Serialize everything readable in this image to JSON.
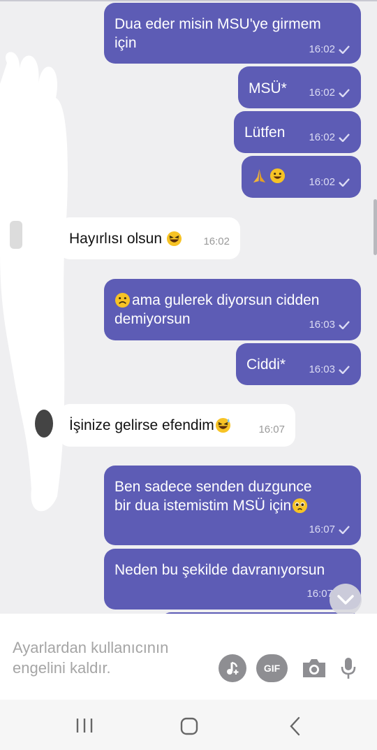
{
  "messages": [
    {
      "dir": "out",
      "text": "Dua eder misin MSU'ye girmem için",
      "time": "16:02"
    },
    {
      "dir": "out",
      "text": "MSÜ*",
      "time": "16:02"
    },
    {
      "dir": "out",
      "text": "Lütfen",
      "time": "16:02"
    },
    {
      "dir": "out",
      "text": "",
      "emoji": [
        "folded-hands",
        "grinning-face"
      ],
      "time": "16:02"
    },
    {
      "dir": "in",
      "text": "Hayırlısı olsun",
      "emoji_after": "grinning-squinting-face",
      "time": "16:02"
    },
    {
      "dir": "out",
      "text": "ama gulerek diyorsun cidden demiyorsun",
      "emoji_before": "frowning-face",
      "time": "16:03"
    },
    {
      "dir": "out",
      "text": "Ciddi*",
      "time": "16:03"
    },
    {
      "dir": "in",
      "text": "İşinize gelirse efendim",
      "emoji_after": "grinning-sweat-face",
      "time": "16:07"
    },
    {
      "dir": "out",
      "text": "Ben sadece senden duzgunce bir dua istemistim MSÜ için",
      "emoji_after": "pleading-face",
      "time": "16:07"
    },
    {
      "dir": "out",
      "text": "Neden bu şekilde davranıyorsun",
      "time": "16:07"
    }
  ],
  "msg1": {
    "line1": "Dua eder misin MSU'ye girmem",
    "line2": "için"
  },
  "msg6": {
    "line1": "ama gulerek diyorsun cidden",
    "line2": "demiyorsun"
  },
  "msg9": {
    "line1": "Ben sadece senden duzgunce",
    "line2": "bir dua istemistim MSÜ için"
  },
  "input": {
    "placeholder_line1": "Ayarlardan kullanıcının",
    "placeholder_line2": "engelini kaldır."
  },
  "icons": [
    "music-note-icon",
    "gif-icon",
    "camera-icon",
    "microphone-icon",
    "scroll-down-chevron-icon"
  ],
  "gif_label": "GIF",
  "colors": {
    "outgoing_bubble": "#5d5cb5",
    "incoming_bubble": "#ffffff",
    "chat_background": "#efeff1",
    "icon_gray": "#8e8e92"
  }
}
